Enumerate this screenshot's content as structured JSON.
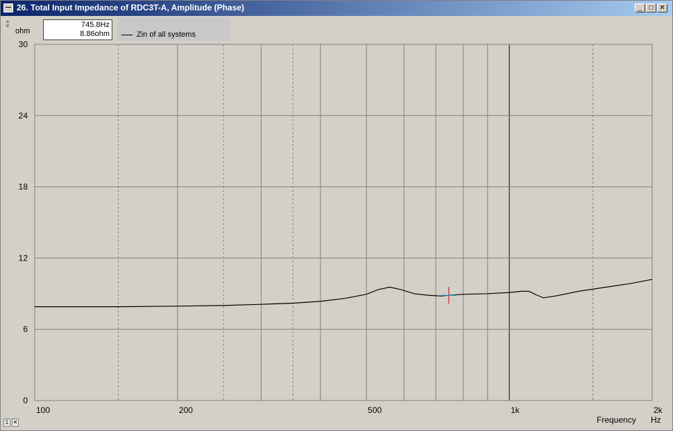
{
  "window": {
    "title": "26. Total Input Impedance of RDC3T-A, Amplitude (Phase)",
    "buttons": {
      "minimize": "_",
      "maximize": "□",
      "close": "✕"
    }
  },
  "readout": {
    "frequency": "745.8Hz",
    "value": "8.86ohm"
  },
  "legend": {
    "series": "Zin of all systems"
  },
  "icons": [
    "scroll-arrows-icon",
    "window-system-icon",
    "status-icon-1",
    "status-icon-2"
  ],
  "chart_data": {
    "type": "line",
    "xlabel": "Frequency",
    "xunit": "Hz",
    "yunit": "ohm",
    "xscale": "log",
    "xlim": [
      100,
      2000
    ],
    "ylim": [
      0,
      30
    ],
    "xticks": [
      {
        "value": 100,
        "label": "100"
      },
      {
        "value": 200,
        "label": "200"
      },
      {
        "value": 500,
        "label": "500"
      },
      {
        "value": 1000,
        "label": "1k"
      },
      {
        "value": 2000,
        "label": "2k"
      }
    ],
    "yticks": [
      {
        "value": 0,
        "label": "0"
      },
      {
        "value": 6,
        "label": "6"
      },
      {
        "value": 12,
        "label": "12"
      },
      {
        "value": 18,
        "label": "18"
      },
      {
        "value": 24,
        "label": "24"
      },
      {
        "value": 30,
        "label": "30"
      }
    ],
    "grid": true,
    "cursor": {
      "x": 745.8,
      "y": 8.86
    },
    "series": [
      {
        "name": "Zin of all systems",
        "x": [
          100,
          150,
          200,
          250,
          300,
          350,
          400,
          450,
          500,
          530,
          560,
          590,
          630,
          680,
          720,
          745.8,
          800,
          900,
          1000,
          1060,
          1100,
          1140,
          1180,
          1250,
          1400,
          1600,
          1800,
          2000
        ],
        "y": [
          7.9,
          7.9,
          7.95,
          8.0,
          8.1,
          8.2,
          8.35,
          8.6,
          8.95,
          9.35,
          9.55,
          9.35,
          9.0,
          8.85,
          8.8,
          8.86,
          8.95,
          9.0,
          9.1,
          9.2,
          9.2,
          8.9,
          8.65,
          8.8,
          9.2,
          9.55,
          9.85,
          10.2
        ]
      }
    ]
  }
}
